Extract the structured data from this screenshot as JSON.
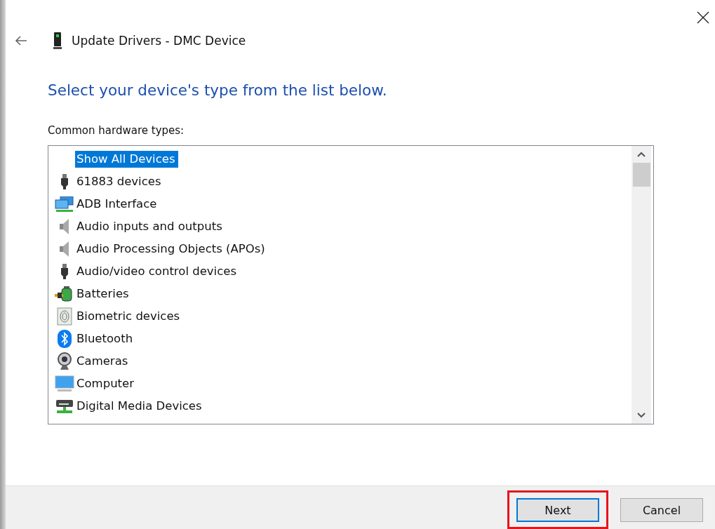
{
  "window": {
    "title": "Update Drivers - DMC Device"
  },
  "heading": "Select your device's type from the list below.",
  "list_label": "Common hardware types:",
  "items": [
    {
      "label": "Show All Devices",
      "kind": "none",
      "selected": true
    },
    {
      "label": "61883 devices",
      "kind": "plug",
      "selected": false
    },
    {
      "label": "ADB Interface",
      "kind": "network",
      "selected": false
    },
    {
      "label": "Audio inputs and outputs",
      "kind": "speaker",
      "selected": false
    },
    {
      "label": "Audio Processing Objects (APOs)",
      "kind": "speaker",
      "selected": false
    },
    {
      "label": "Audio/video control devices",
      "kind": "plug",
      "selected": false
    },
    {
      "label": "Batteries",
      "kind": "battery",
      "selected": false
    },
    {
      "label": "Biometric devices",
      "kind": "fingerprint",
      "selected": false
    },
    {
      "label": "Bluetooth",
      "kind": "bluetooth",
      "selected": false
    },
    {
      "label": "Cameras",
      "kind": "camera",
      "selected": false
    },
    {
      "label": "Computer",
      "kind": "monitor",
      "selected": false
    },
    {
      "label": "Digital Media Devices",
      "kind": "media",
      "selected": false
    }
  ],
  "buttons": [
    {
      "label": "Next",
      "focused": true,
      "highlighted": true
    },
    {
      "label": "Cancel",
      "focused": false,
      "highlighted": false
    }
  ]
}
